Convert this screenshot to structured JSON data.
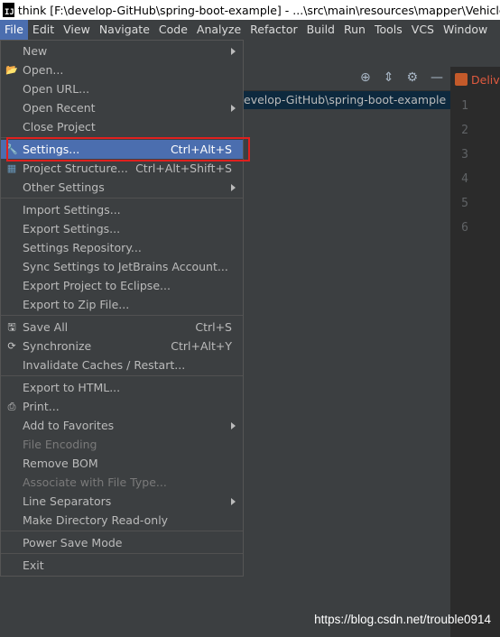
{
  "title_bar": {
    "app_icon_text": "IJ",
    "title": "think [F:\\develop-GitHub\\spring-boot-example] - ...\\src\\main\\resources\\mapper\\VehicleTra"
  },
  "menubar": [
    "File",
    "Edit",
    "View",
    "Navigate",
    "Code",
    "Analyze",
    "Refactor",
    "Build",
    "Run",
    "Tools",
    "VCS",
    "Window"
  ],
  "project_panel": {
    "path_text": "evelop-GitHub\\spring-boot-example",
    "tool_icons": [
      "target-icon",
      "collapse-icon",
      "gear-icon",
      "minimize-icon"
    ]
  },
  "editor": {
    "tab_label": "Deliv",
    "line_numbers": [
      "1",
      "2",
      "3",
      "4",
      "5",
      "6"
    ]
  },
  "file_menu": {
    "groups": [
      [
        {
          "label": "New",
          "submenu": true,
          "icon": ""
        },
        {
          "label": "Open...",
          "icon": "folder-icon"
        },
        {
          "label": "Open URL...",
          "icon": ""
        },
        {
          "label": "Open Recent",
          "submenu": true,
          "icon": ""
        },
        {
          "label": "Close Project",
          "icon": ""
        }
      ],
      [
        {
          "label": "Settings...",
          "shortcut": "Ctrl+Alt+S",
          "icon": "wrench-icon",
          "selected": true
        },
        {
          "label": "Project Structure...",
          "shortcut": "Ctrl+Alt+Shift+S",
          "icon": "project-structure-icon"
        },
        {
          "label": "Other Settings",
          "submenu": true,
          "icon": ""
        }
      ],
      [
        {
          "label": "Import Settings...",
          "icon": ""
        },
        {
          "label": "Export Settings...",
          "icon": ""
        },
        {
          "label": "Settings Repository...",
          "icon": ""
        },
        {
          "label": "Sync Settings to JetBrains Account...",
          "icon": ""
        },
        {
          "label": "Export Project to Eclipse...",
          "icon": ""
        },
        {
          "label": "Export to Zip File...",
          "icon": ""
        }
      ],
      [
        {
          "label": "Save All",
          "shortcut": "Ctrl+S",
          "icon": "save-icon"
        },
        {
          "label": "Synchronize",
          "shortcut": "Ctrl+Alt+Y",
          "icon": "sync-icon"
        },
        {
          "label": "Invalidate Caches / Restart...",
          "icon": ""
        }
      ],
      [
        {
          "label": "Export to HTML...",
          "icon": ""
        },
        {
          "label": "Print...",
          "icon": "print-icon"
        },
        {
          "label": "Add to Favorites",
          "submenu": true,
          "icon": ""
        },
        {
          "label": "File Encoding",
          "disabled": true,
          "icon": ""
        },
        {
          "label": "Remove BOM",
          "icon": ""
        },
        {
          "label": "Associate with File Type...",
          "disabled": true,
          "icon": ""
        },
        {
          "label": "Line Separators",
          "submenu": true,
          "icon": ""
        },
        {
          "label": "Make Directory Read-only",
          "icon": ""
        }
      ],
      [
        {
          "label": "Power Save Mode",
          "icon": ""
        }
      ],
      [
        {
          "label": "Exit",
          "icon": ""
        }
      ]
    ]
  },
  "watermark": "https://blog.csdn.net/trouble0914",
  "colors": {
    "menu_bg": "#3c3f41",
    "selected_bg": "#4b6eaf",
    "highlight_border": "#e0201e"
  }
}
